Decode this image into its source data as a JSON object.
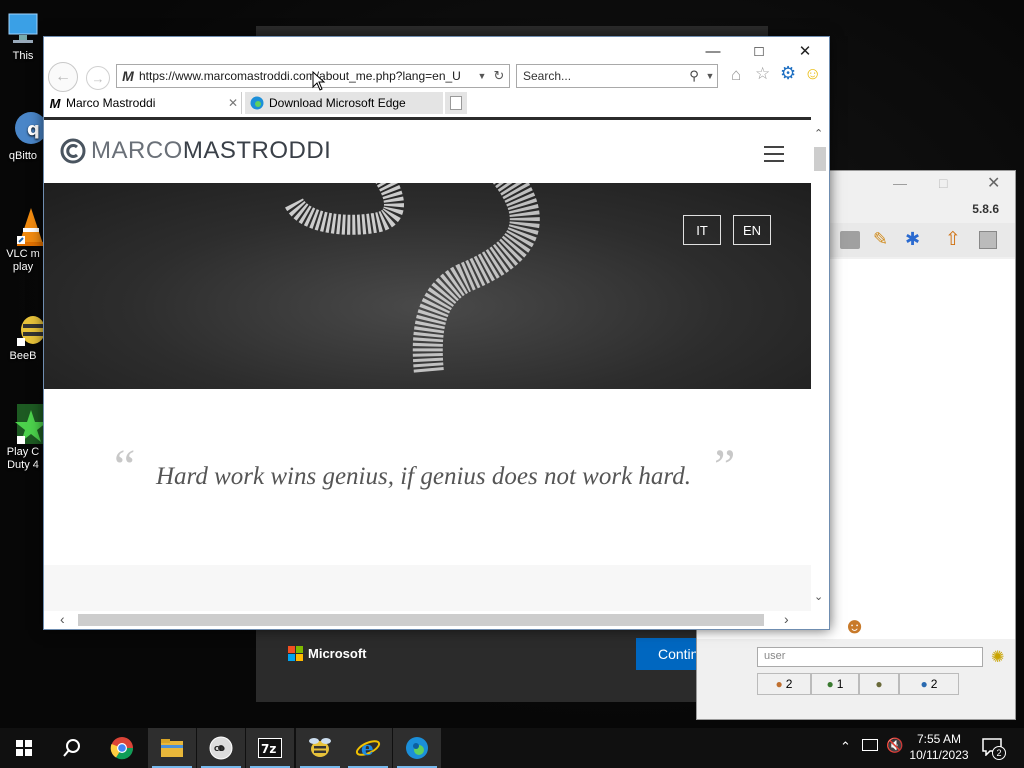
{
  "desktop": {
    "icons": [
      {
        "label": "This"
      },
      {
        "label": "qBitto"
      },
      {
        "label": "VLC m\nplay"
      },
      {
        "label": "BeeB"
      },
      {
        "label": "Play C\nDuty 4"
      }
    ]
  },
  "bee_window": {
    "version": "5.8.6",
    "user_placeholder": "user",
    "status_counts": [
      "2",
      "1",
      "",
      "2"
    ]
  },
  "edge_setup": {
    "brand": "Microsoft",
    "continue_label": "Continue"
  },
  "browser": {
    "address": "https://www.marcomastroddi.com/about_me.php?lang=en_U",
    "search_placeholder": "Search...",
    "tabs": [
      {
        "title": "Marco Mastroddi",
        "active": true
      },
      {
        "title": "Download Microsoft Edge",
        "active": false
      }
    ]
  },
  "page": {
    "logo_light": "MARCO",
    "logo_bold": "MASTRODDI",
    "lang_it": "IT",
    "lang_en": "EN",
    "quote": "Hard work wins genius, if genius does not work hard.",
    "quote_open": "“",
    "quote_close": "”"
  },
  "taskbar": {
    "time": "7:55 AM",
    "date": "10/11/2023",
    "notifications": "2"
  },
  "colors": {
    "ie_blue": "#1e6fc2",
    "edge_continue": "#0067c0",
    "taskbar": "#101010"
  }
}
